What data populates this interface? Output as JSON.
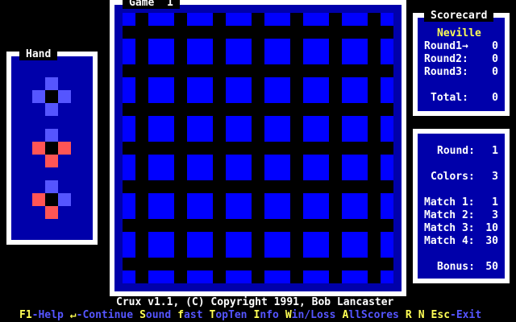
{
  "game": {
    "title": "Game  1",
    "grid_rows": 8,
    "grid_cols": 8,
    "copyright": "Crux v1.1, (C) Copyright 1991, Bob Lancaster"
  },
  "hand": {
    "title": "Hand",
    "pieces": [
      {
        "top": "#5555ff",
        "left": "#5555ff",
        "right": "#5555ff",
        "bottom": "#5555ff"
      },
      {
        "top": "#5555ff",
        "left": "#ff5555",
        "right": "#ff5555",
        "bottom": "#ff5555"
      },
      {
        "top": "#5555ff",
        "left": "#ff5555",
        "right": "#5555ff",
        "bottom": "#ff5555"
      }
    ]
  },
  "scorecard": {
    "title": "Scorecard",
    "player": "Neville",
    "rows": [
      {
        "label": "Round1→",
        "value": "0"
      },
      {
        "label": "Round2:",
        "value": "0"
      },
      {
        "label": "Round3:",
        "value": "0"
      }
    ],
    "total_label": "Total:",
    "total_value": "0"
  },
  "status": {
    "round_label": "Round:",
    "round_value": "1",
    "colors_label": "Colors:",
    "colors_value": "3",
    "matches": [
      {
        "label": "Match 1:",
        "value": "1"
      },
      {
        "label": "Match 2:",
        "value": "3"
      },
      {
        "label": "Match 3:",
        "value": "10"
      },
      {
        "label": "Match 4:",
        "value": "30"
      }
    ],
    "bonus_label": "Bonus:",
    "bonus_value": "50"
  },
  "menu": [
    {
      "hot": "F1",
      "rest": "-Help"
    },
    {
      "hot": "↵",
      "rest": "-Continue"
    },
    {
      "hot": "S",
      "rest": "ound"
    },
    {
      "hot": "f",
      "rest": "ast"
    },
    {
      "hot": "T",
      "rest": "opTen"
    },
    {
      "hot": "I",
      "rest": "nfo"
    },
    {
      "hot": "W",
      "rest": "in/Loss"
    },
    {
      "hot": "A",
      "rest": "llScores"
    },
    {
      "hot": "R",
      "rest": ""
    },
    {
      "hot": "N",
      "rest": ""
    },
    {
      "hot": "Esc",
      "rest": "-Exit"
    }
  ],
  "colors": {
    "panel": "#0000aa",
    "cell": "#0000ff",
    "hotkey": "#ffff55",
    "menu_text": "#5555ff"
  }
}
